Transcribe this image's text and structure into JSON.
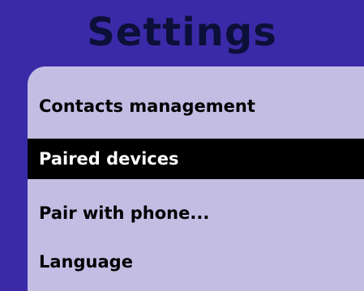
{
  "header": {
    "title": "Settings"
  },
  "menu": {
    "items": [
      {
        "label": "Contacts management",
        "selected": false
      },
      {
        "label": "Paired devices",
        "selected": true
      },
      {
        "label": "Pair with phone...",
        "selected": false
      },
      {
        "label": "Language",
        "selected": false
      }
    ]
  },
  "colors": {
    "background": "#3a2aa8",
    "title_text": "#0c1038",
    "panel": "#c3bde4",
    "selected_background": "#000000",
    "selected_text": "#ffffff",
    "item_text": "#000000"
  }
}
